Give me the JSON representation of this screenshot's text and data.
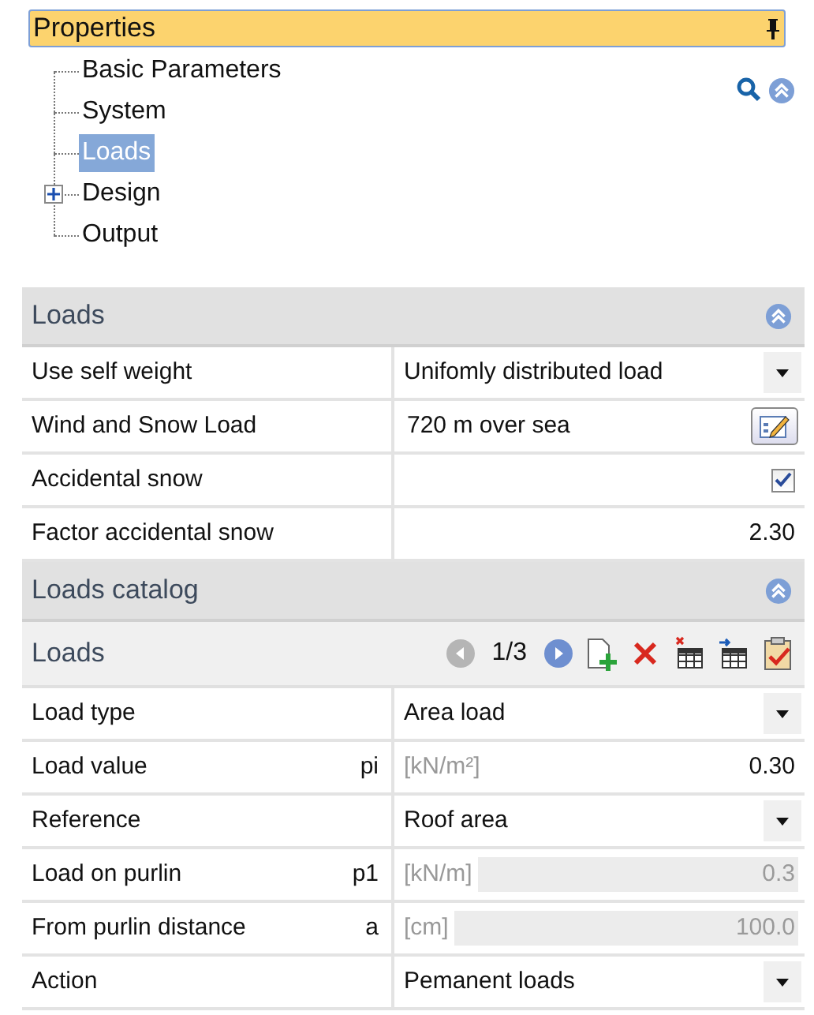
{
  "panel": {
    "title": "Properties"
  },
  "tree": [
    {
      "label": "Basic Parameters",
      "selected": false
    },
    {
      "label": "System",
      "selected": false
    },
    {
      "label": "Loads",
      "selected": true
    },
    {
      "label": "Design",
      "selected": false,
      "expanded": false
    },
    {
      "label": "Output",
      "selected": false
    }
  ],
  "sections": [
    {
      "title": "Loads",
      "expanded": true,
      "rows": [
        {
          "kind": "dropdown",
          "label": "Use self weight",
          "value": "Unifomly distributed load"
        },
        {
          "kind": "button",
          "label": "Wind and Snow Load",
          "value": "720 m over sea"
        },
        {
          "kind": "checkbox",
          "label": "Accidental snow",
          "checked": true
        },
        {
          "kind": "number",
          "label": "Factor accidental snow",
          "value": "2.30",
          "disabled": false
        }
      ]
    },
    {
      "title": "Loads catalog",
      "expanded": true,
      "subheader": {
        "title": "Loads",
        "counter": "1/3",
        "prev_enabled": false,
        "next_enabled": true
      },
      "rows": [
        {
          "kind": "dropdown",
          "label": "Load type",
          "value": "Area load"
        },
        {
          "kind": "number",
          "label": "Load value",
          "symbol": "pi",
          "unit": "[kN/m²]",
          "value": "0.30",
          "disabled": false
        },
        {
          "kind": "dropdown",
          "label": "Reference",
          "value": "Roof area"
        },
        {
          "kind": "number",
          "label": "Load on purlin",
          "symbol": "p1",
          "unit": "[kN/m]",
          "value": "0.3",
          "disabled": true
        },
        {
          "kind": "number",
          "label": "From purlin distance",
          "symbol": "a",
          "unit": "[cm]",
          "value": "100.0",
          "disabled": true
        },
        {
          "kind": "dropdown",
          "label": "Action",
          "value": "Pemanent loads"
        }
      ]
    }
  ]
}
